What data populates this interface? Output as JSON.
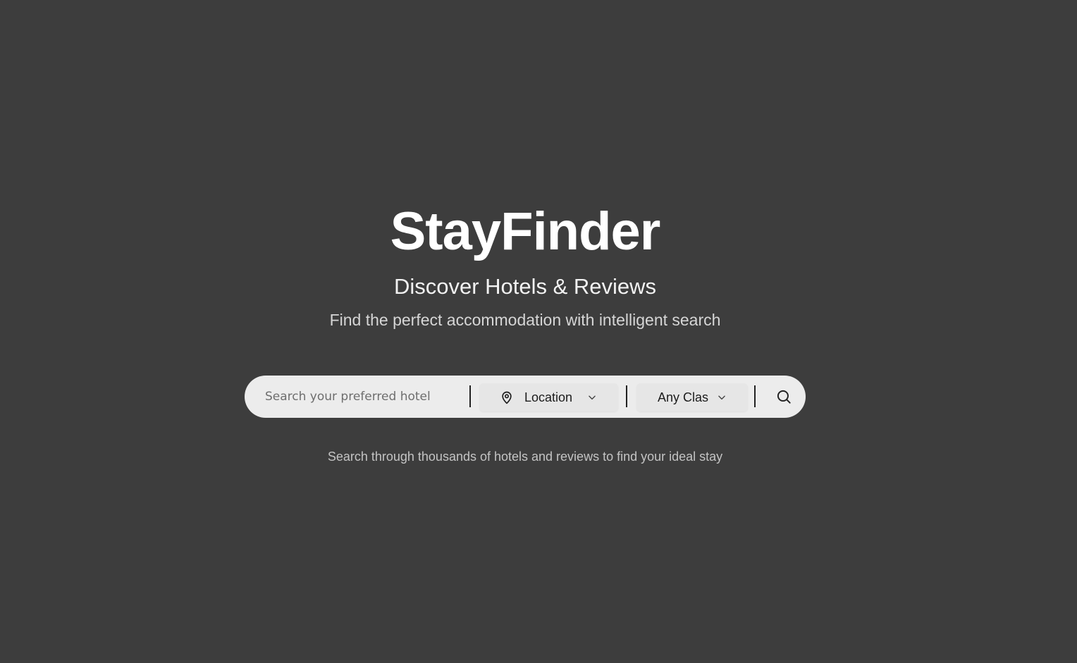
{
  "hero": {
    "title": "StayFinder",
    "subtitle": "Discover Hotels & Reviews",
    "tagline": "Find the perfect accommodation with intelligent search"
  },
  "search": {
    "placeholder": "Search your preferred hotel",
    "value": "",
    "location_label": "Location",
    "class_label": "Any Clas",
    "search_icon": "search-icon",
    "location_icon": "map-pin-icon",
    "dropdown_icon": "chevron-down-icon"
  },
  "helper_text": "Search through thousands of hotels and reviews to find your ideal stay",
  "colors": {
    "background": "#3d3d3d",
    "searchbar": "#ececec",
    "title": "#ffffff"
  }
}
